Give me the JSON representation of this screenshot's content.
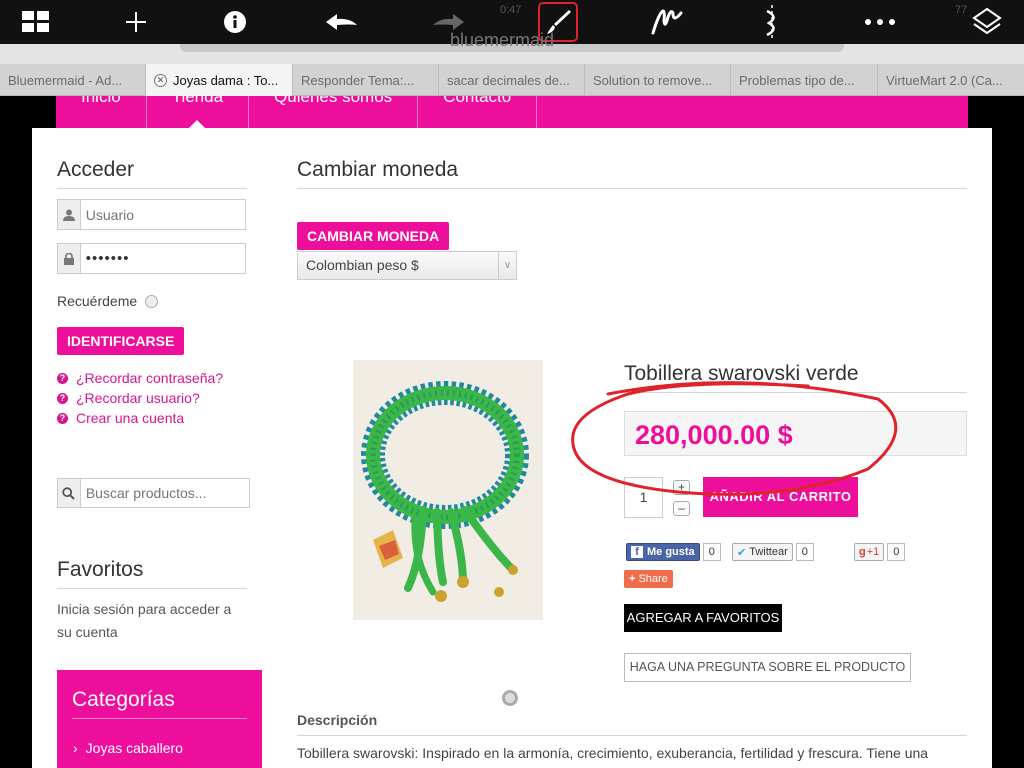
{
  "toolbar": {
    "status_time": "0:47",
    "url_text": "bluemermaid",
    "battery_text": "77"
  },
  "tabs": [
    {
      "label": "Bluemermaid - Ad..."
    },
    {
      "label": "Joyas dama : To...",
      "active": true
    },
    {
      "label": "Responder Tema:..."
    },
    {
      "label": "sacar decimales de..."
    },
    {
      "label": "Solution to remove..."
    },
    {
      "label": "Problemas tipo de..."
    },
    {
      "label": "VirtueMart 2.0 (Ca..."
    }
  ],
  "nav": {
    "items": [
      "Inicio",
      "Tienda",
      "Quienes somos",
      "Contacto"
    ],
    "active": "Tienda"
  },
  "sidebar": {
    "login_title": "Acceder",
    "username_placeholder": "Usuario",
    "password_value": "•••••••",
    "remember_label": "Recuérdeme",
    "login_button": "IDENTIFICARSE",
    "links": [
      "¿Recordar contraseña?",
      "¿Recordar usuario?",
      "Crear una cuenta"
    ],
    "search_placeholder": "Buscar productos...",
    "favorites_title": "Favoritos",
    "favorites_text_1": "Inicia sesión para acceder a",
    "favorites_text_2": "su cuenta",
    "categories_title": "Categorías",
    "categories_item": "Joyas caballero"
  },
  "currency": {
    "title": "Cambiar moneda",
    "button": "CAMBIAR MONEDA",
    "selected": "Colombian peso $"
  },
  "product": {
    "title": "Tobillera swarovski verde",
    "price": "280,000.00 $",
    "qty": "1",
    "qty_plus": "+",
    "qty_minus": "–",
    "add_to_cart": "AÑADIR AL CARRITO",
    "social": {
      "fb_label": "Me gusta",
      "fb_count": "0",
      "tw_label": "Twittear",
      "tw_count": "0",
      "gp_label": "+1",
      "gp_count": "0",
      "share_label": "Share"
    },
    "favorites_button": "AGREGAR A FAVORITOS",
    "ask_button": "HAGA UNA PREGUNTA SOBRE EL PRODUCTO",
    "description_title": "Descripción",
    "description_text": "Tobillera swarovski: Inspirado en la armonía, crecimiento, exuberancia, fertilidad y frescura. Tiene una"
  },
  "colors": {
    "accent": "#ee0e9c",
    "annotation": "#e0222a"
  }
}
